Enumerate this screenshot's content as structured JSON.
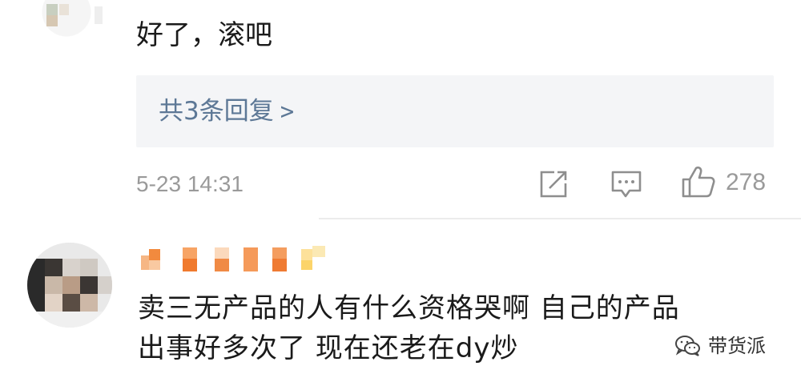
{
  "comments": [
    {
      "text": "好了，滚吧",
      "reply_link": "共3条回复",
      "reply_chevron": ">",
      "timestamp": "5-23 14:31",
      "like_count": "278"
    },
    {
      "text_line1": "卖三无产品的人有什么资格哭啊 自己的产品",
      "text_line2": "出事好多次了 现在还老在dy炒"
    }
  ],
  "watermark": {
    "text": "带货派",
    "icon": "wechat-icon"
  },
  "icons": [
    "share-icon",
    "comment-icon",
    "like-icon"
  ],
  "colors": {
    "reply_link": "#5d7896",
    "muted": "#9a9a9a",
    "reply_box_bg": "#f4f5f7"
  }
}
